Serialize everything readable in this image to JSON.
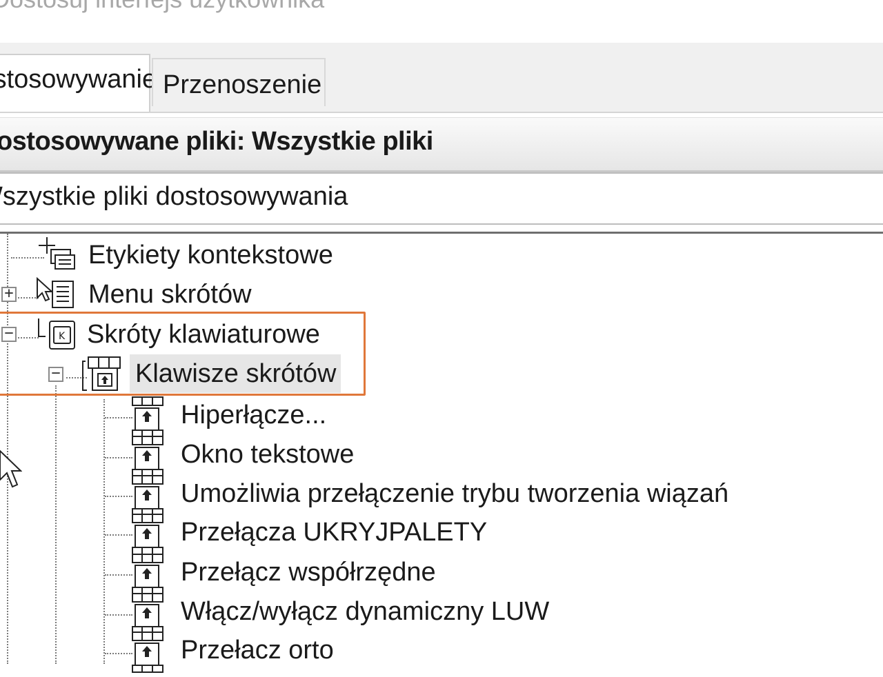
{
  "window": {
    "title": "Dostosuj interfejs użytkownika"
  },
  "tabs": [
    {
      "label": "Dostosowywanie",
      "active": true
    },
    {
      "label": "Przenoszenie",
      "active": false
    }
  ],
  "panel": {
    "header": "Dostosowywane pliki: Wszystkie pliki",
    "filter_value": "Wszystkie pliki dostosowywania"
  },
  "tree": {
    "context_labels": {
      "label": "Etykiety kontekstowe",
      "icon": "context-label-icon"
    },
    "shortcut_menus": {
      "label": "Menu skrótów",
      "icon": "shortcut-menu-icon",
      "expander": "+"
    },
    "keyboard_shortcuts": {
      "label": "Skróty klawiaturowe",
      "icon": "keyboard-shortcuts-icon",
      "expander": "−"
    },
    "shortcut_keys": {
      "label": "Klawisze skrótów",
      "icon": "shortcut-keys-icon",
      "expander": "−"
    },
    "commands": [
      {
        "label": "Hiperłącze..."
      },
      {
        "label": "Okno tekstowe"
      },
      {
        "label": "Umożliwia przełączenie trybu tworzenia wiązań"
      },
      {
        "label": "Przełącza UKRYJPALETY"
      },
      {
        "label": "Przełącz współrzędne"
      },
      {
        "label": "Włącz/wyłącz dynamiczny LUW"
      },
      {
        "label": "Przełacz orto"
      }
    ]
  },
  "colors": {
    "highlight": "#e0773a",
    "selection": "#e6e6e6"
  }
}
